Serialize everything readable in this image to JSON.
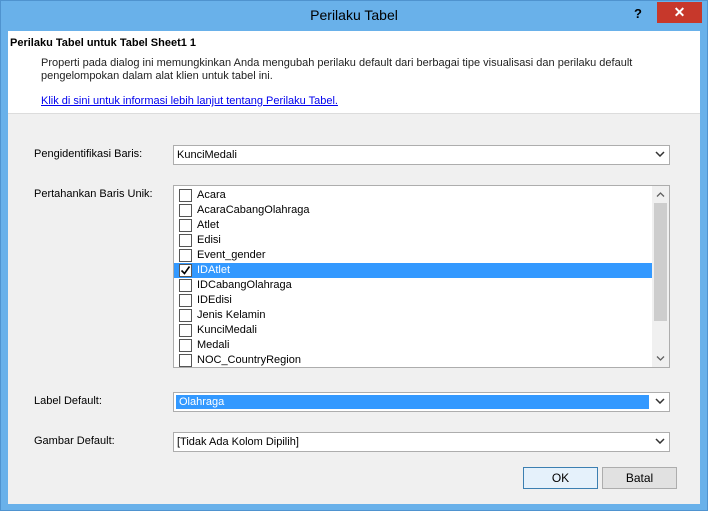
{
  "window": {
    "title": "Perilaku Tabel",
    "help_glyph": "?",
    "close_glyph": "✕"
  },
  "header": {
    "title": "Perilaku Tabel untuk Tabel Sheet1 1",
    "description": "Properti pada dialog ini memungkinkan Anda mengubah perilaku default dari berbagai tipe visualisasi dan perilaku default pengelompokan dalam alat klien untuk tabel ini.",
    "link": "Klik di sini untuk informasi lebih lanjut tentang Perilaku Tabel."
  },
  "row_identifier": {
    "label": "Pengidentifikasi Baris:",
    "value": "KunciMedali"
  },
  "keep_unique_rows": {
    "label": "Pertahankan Baris Unik:",
    "items": [
      {
        "label": "Acara",
        "checked": false,
        "selected": false
      },
      {
        "label": "AcaraCabangOlahraga",
        "checked": false,
        "selected": false
      },
      {
        "label": "Atlet",
        "checked": false,
        "selected": false
      },
      {
        "label": "Edisi",
        "checked": false,
        "selected": false
      },
      {
        "label": "Event_gender",
        "checked": false,
        "selected": false
      },
      {
        "label": "IDAtlet",
        "checked": true,
        "selected": true
      },
      {
        "label": "IDCabangOlahraga",
        "checked": false,
        "selected": false
      },
      {
        "label": "IDEdisi",
        "checked": false,
        "selected": false
      },
      {
        "label": "Jenis Kelamin",
        "checked": false,
        "selected": false
      },
      {
        "label": "KunciMedali",
        "checked": false,
        "selected": false
      },
      {
        "label": "Medali",
        "checked": false,
        "selected": false
      },
      {
        "label": "NOC_CountryRegion",
        "checked": false,
        "selected": false
      }
    ]
  },
  "default_label": {
    "label": "Label Default:",
    "value": "Olahraga"
  },
  "default_image": {
    "label": "Gambar Default:",
    "value": "[Tidak Ada Kolom Dipilih]"
  },
  "buttons": {
    "ok": "OK",
    "cancel": "Batal"
  },
  "icons": {
    "dropdown": "chevron-down-icon",
    "check": "checkmark-icon",
    "scroll_up": "scroll-up-arrow-icon",
    "scroll_down": "scroll-down-arrow-icon"
  },
  "colors": {
    "titlebar": "#69b1ea",
    "close_button": "#c7382b",
    "selection": "#3399ff",
    "link": "#0000ee"
  }
}
